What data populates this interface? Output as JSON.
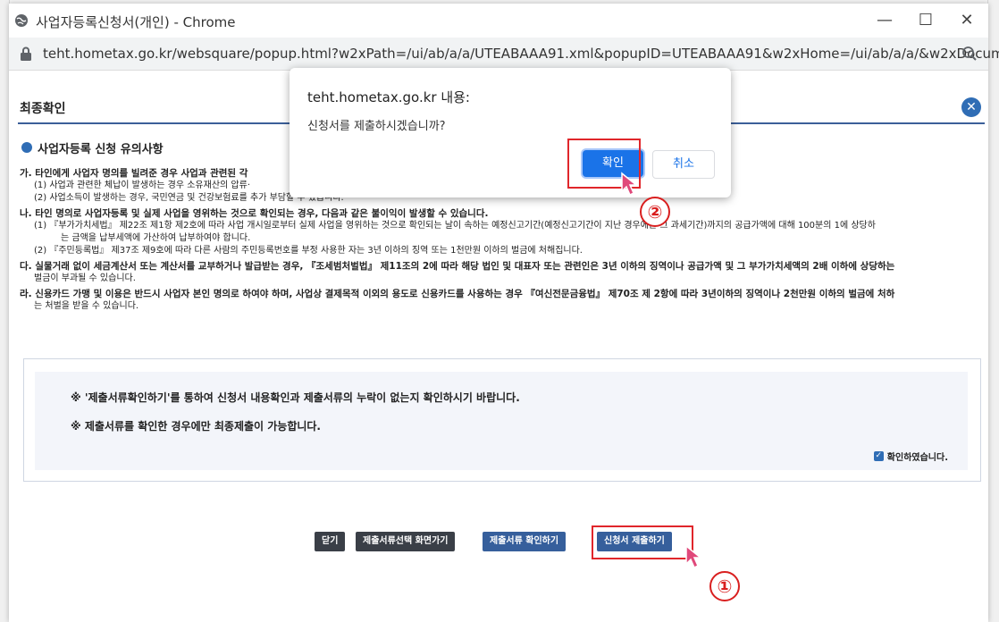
{
  "window": {
    "title": "사업자등록신청서(개인) - Chrome",
    "url": "teht.hometax.go.kr/websquare/popup.html?w2xPath=/ui/ab/a/a/UTEABAAA91.xml&popupID=UTEABAAA91&w2xHome=/ui/ab/a/a/&w2xDocum..."
  },
  "page": {
    "section_title": "최종확인",
    "sub_title": "사업자등록 신청 유의사항",
    "notes": [
      {
        "type": "h",
        "text": "가. 타인에게 사업자 명의를 빌려준 경우 사업과 관련된 각"
      },
      {
        "type": "i",
        "text": "(1) 사업과 관련한 체납이 발생하는 경우 소유재산의 압류·"
      },
      {
        "type": "i",
        "text": "(2) 사업소득이 발생하는 경우, 국민연금 및 건강보험료를 추가 부담할 수 있습니다."
      },
      {
        "type": "h",
        "text": "나. 타인 명의로 사업자등록 및 실제 사업을 영위하는 것으로 확인되는 경우, 다음과 같은 불이익이 발생할 수 있습니다."
      },
      {
        "type": "i",
        "text": "(1) 『부가가치세법』 제22조 제1항 제2호에 따라 사업 개시일로부터 실제 사업을 영위하는 것으로 확인되는 날이 속하는 예정신고기간(예정신고기간이 지난 경우에는 그 과세기간)까지의 공급가액에 대해 100분의 1에 상당하"
      },
      {
        "type": "i2",
        "text": "는 금액을 납부세액에 가산하여 납부하여야 합니다."
      },
      {
        "type": "i",
        "text": "(2) 『주민등록법』 제37조 제9호에 따라 다른 사람의 주민등록번호를 부정 사용한 자는 3년 이하의 징역 또는 1천만원 이하의 벌금에 처해집니다."
      },
      {
        "type": "h",
        "text": "다. 실물거래 없이 세금계산서 또는 계산서를 교부하거나 발급받는 경우, 『조세범처벌법』 제11조의 2에 따라 해당 법인 및 대표자 또는 관련인은 3년 이하의 징역이나 공급가액 및 그 부가가치세액의 2배 이하에 상당하는"
      },
      {
        "type": "i",
        "text": "벌금이 부과될 수 있습니다."
      },
      {
        "type": "h",
        "text": "라. 신용카드 가맹 및 이용은 반드시 사업자 본인 명의로 하여야 하며, 사업상 결제목적 이외의 용도로 신용카드를 사용하는 경우 『여신전문금융법』 제70조 제 2항에 따라 3년이하의 징역이나 2천만원 이하의 벌금에 처하"
      },
      {
        "type": "i",
        "text": "는 처벌을 받을 수 있습니다."
      }
    ],
    "confirm_line1": "※  '제출서류확인하기'를 통하여 신청서 내용확인과 제출서류의 누락이 없는지 확인하시기 바랍니다.",
    "confirm_line2": "※  제출서류를 확인한 경우에만 최종제출이 가능합니다.",
    "checkbox_label": "확인하였습니다.",
    "buttons": {
      "close": "닫기",
      "select_docs": "제출서류선택 화면가기",
      "check_docs": "제출서류 확인하기",
      "submit": "신청서 제출하기"
    }
  },
  "dialog": {
    "title": "teht.hometax.go.kr 내용:",
    "message": "신청서를 제출하시겠습니까?",
    "ok": "확인",
    "cancel": "취소"
  },
  "annotations": {
    "step1": "①",
    "step2": "②"
  }
}
